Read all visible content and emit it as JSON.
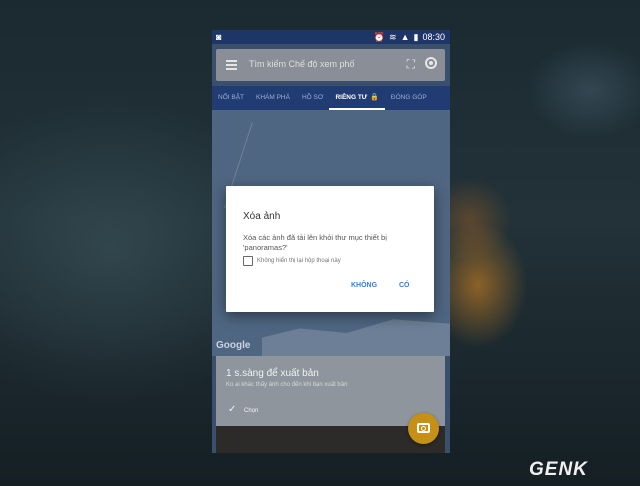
{
  "status": {
    "time": "08:30",
    "left_icon": "camera-icon",
    "icons": [
      "alarm-icon",
      "wifi-icon",
      "signal-icon",
      "battery-icon"
    ]
  },
  "search": {
    "placeholder": "Tìm kiếm Chế độ xem phố",
    "menu_icon": "menu-icon",
    "expand_icon": "fullscreen-icon",
    "location_icon": "my-location-icon"
  },
  "tabs": [
    {
      "label": "NỔI BẬT"
    },
    {
      "label": "KHÁM PHÁ"
    },
    {
      "label": "HỒ SƠ"
    },
    {
      "label": "RIÊNG TƯ",
      "active": true,
      "icon": "lock-icon"
    },
    {
      "label": "ĐÓNG GÓP"
    }
  ],
  "map": {
    "brand": "Google"
  },
  "sheet": {
    "title": "1 s.sàng để xuất bản",
    "subtitle": "Ko ai khác thấy ảnh cho đến khi bạn xuất bản",
    "check_label": "Chọn"
  },
  "dialog": {
    "title": "Xóa ảnh",
    "message": "Xóa các ảnh đã tải lên khỏi thư mục thiết bị 'panoramas?'",
    "checkbox_label": "Không hiển thị lại hộp thoại này",
    "no_button": "KHÔNG",
    "yes_button": "CÓ"
  },
  "watermark": "GENK",
  "colors": {
    "status_bar": "#1e3568",
    "tab_bar": "#213b73",
    "accent": "#3a7bd5",
    "fab": "#c68f15"
  }
}
